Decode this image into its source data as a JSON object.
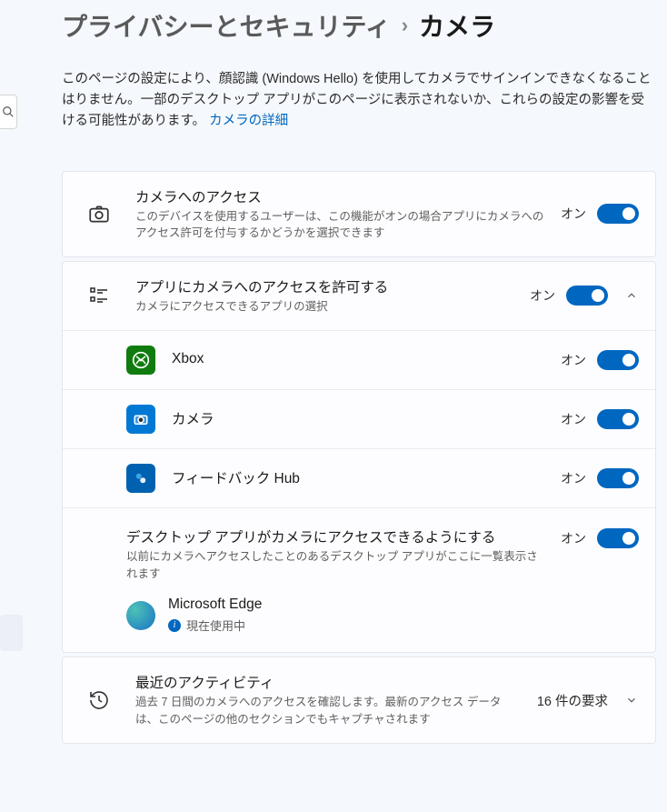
{
  "breadcrumb": {
    "parent": "プライバシーとセキュリティ",
    "separator": "›",
    "current": "カメラ"
  },
  "description": "このページの設定により、顔認識 (Windows Hello) を使用してカメラでサインインできなくなることはりません。一部のデスクトップ アプリがこのページに表示されないか、これらの設定の影響を受ける可能性があります。",
  "description_link": "カメラの詳細",
  "rows": {
    "camera_access": {
      "title": "カメラへのアクセス",
      "subtitle": "このデバイスを使用するユーザーは、この機能がオンの場合アプリにカメラへのアクセス許可を付与するかどうかを選択できます",
      "state": "オン"
    },
    "apps_access": {
      "title": "アプリにカメラへのアクセスを許可する",
      "subtitle": "カメラにアクセスできるアプリの選択",
      "state": "オン"
    },
    "xbox": {
      "name": "Xbox",
      "state": "オン"
    },
    "camera_app": {
      "name": "カメラ",
      "state": "オン"
    },
    "feedback": {
      "name": "フィードバック Hub",
      "state": "オン"
    },
    "desktop_apps": {
      "title": "デスクトップ アプリがカメラにアクセスできるようにする",
      "subtitle": "以前にカメラへアクセスしたことのあるデスクトップ アプリがここに一覧表示されます",
      "state": "オン"
    },
    "edge": {
      "name": "Microsoft Edge",
      "status": "現在使用中"
    },
    "recent": {
      "title": "最近のアクティビティ",
      "subtitle": "過去 7 日間のカメラへのアクセスを確認します。最新のアクセス データは、このページの他のセクションでもキャプチャされます",
      "aux": "16 件の要求"
    }
  }
}
